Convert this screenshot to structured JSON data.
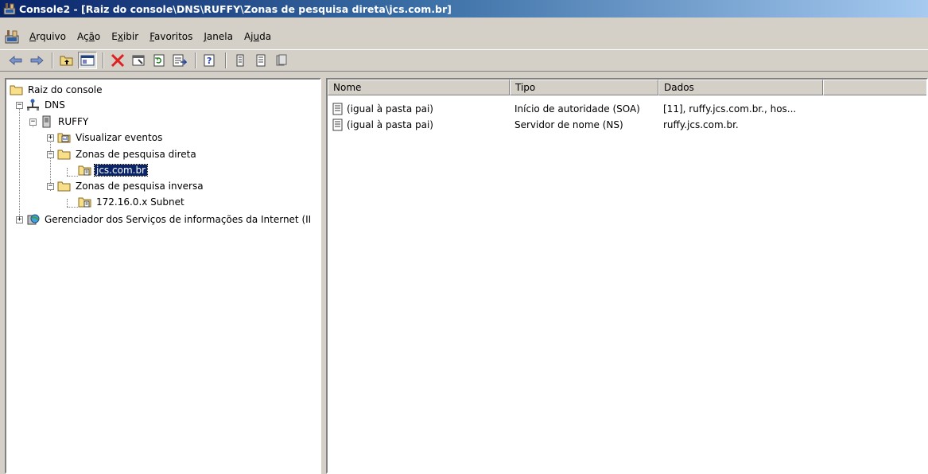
{
  "window": {
    "title": "Console2 - [Raiz do console\\DNS\\RUFFY\\Zonas de pesquisa direta\\jcs.com.br]"
  },
  "menu": {
    "items": [
      {
        "label": "Arquivo",
        "accel_index": 0
      },
      {
        "label": "Ação",
        "accel_index": 2
      },
      {
        "label": "Exibir",
        "accel_index": 1
      },
      {
        "label": "Favoritos",
        "accel_index": 0
      },
      {
        "label": "Janela",
        "accel_index": 0
      },
      {
        "label": "Ajuda",
        "accel_index": 2
      }
    ]
  },
  "toolbar": {
    "buttons": [
      "back-arrow-icon",
      "forward-arrow-icon",
      "up-folder-icon",
      "show-hide-tree-icon",
      "delete-icon",
      "properties-icon",
      "refresh-icon",
      "export-list-icon",
      "help-icon",
      "record-icon",
      "record-icon",
      "record-icon"
    ]
  },
  "tree": {
    "root": "Raiz do console",
    "dns": "DNS",
    "server": "RUFFY",
    "events": "Visualizar eventos",
    "forward_zones": "Zonas de pesquisa direta",
    "zone_selected": "jcs.com.br",
    "reverse_zones": "Zonas de pesquisa inversa",
    "reverse_zone": "172.16.0.x Subnet",
    "iis": "Gerenciador dos Serviços de informações da Internet (II"
  },
  "list": {
    "columns": [
      "Nome",
      "Tipo",
      "Dados"
    ],
    "rows": [
      {
        "name": "(igual à pasta pai)",
        "type": "Início de autoridade (SOA)",
        "data": "[11], ruffy.jcs.com.br., hos..."
      },
      {
        "name": "(igual à pasta pai)",
        "type": "Servidor de nome (NS)",
        "data": "ruffy.jcs.com.br."
      }
    ]
  },
  "colors": {
    "title_bar_start": "#0a246a",
    "title_bar_end": "#a6caf0",
    "selection": "#0a246a",
    "window_face": "#d4d0c8"
  }
}
